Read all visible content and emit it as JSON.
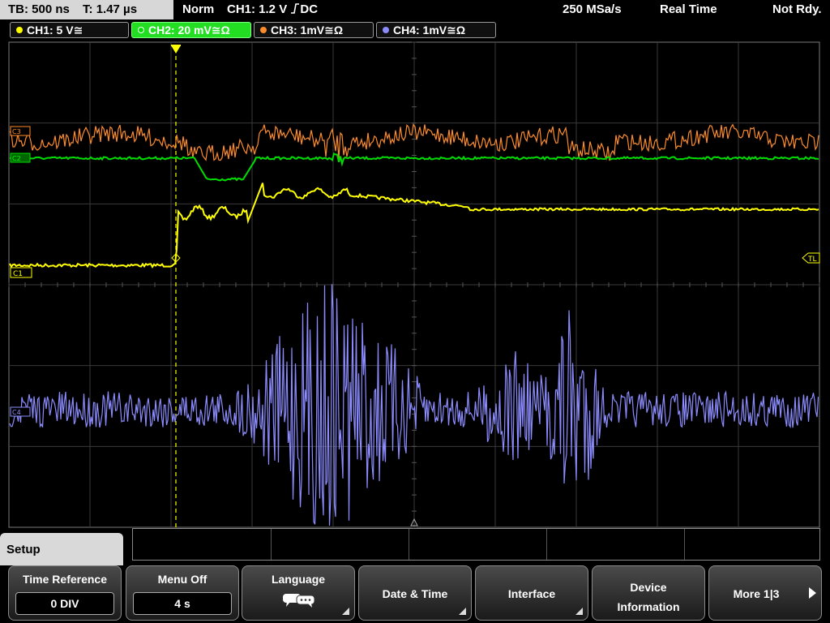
{
  "topbar": {
    "timebase": "TB: 500 ns",
    "trigger_time": "T: 1.47 µs",
    "mode": "Norm",
    "trigger_setting": "CH1: 1.2 V",
    "trigger_coupling": "DC",
    "sample_rate": "250 MSa/s",
    "acq_mode": "Real Time",
    "status": "Not Rdy."
  },
  "channels": [
    {
      "label": "CH1: 5 V≅",
      "color": "#ffff00",
      "active": false
    },
    {
      "label": "CH2: 20 mV≅Ω",
      "color": "#00dd00",
      "active": true
    },
    {
      "label": "CH3: 1mV≅Ω",
      "color": "#ff8c2a",
      "active": false
    },
    {
      "label": "CH4: 1mV≅Ω",
      "color": "#8c8cff",
      "active": false
    }
  ],
  "markers": {
    "ch1": "C1",
    "ch2": "C2",
    "ch3": "C3",
    "ch4": "C4",
    "trigger_level": "TL"
  },
  "menu": {
    "title": "Setup",
    "buttons": [
      {
        "label": "Time Reference",
        "value": "0 DIV"
      },
      {
        "label": "Menu Off",
        "value": "4 s"
      },
      {
        "label": "Language",
        "icon": "speech-bubbles-icon"
      },
      {
        "label": "Date & Time"
      },
      {
        "label": "Interface"
      },
      {
        "label": "Device\nInformation"
      },
      {
        "label": "More 1|3"
      }
    ]
  }
}
